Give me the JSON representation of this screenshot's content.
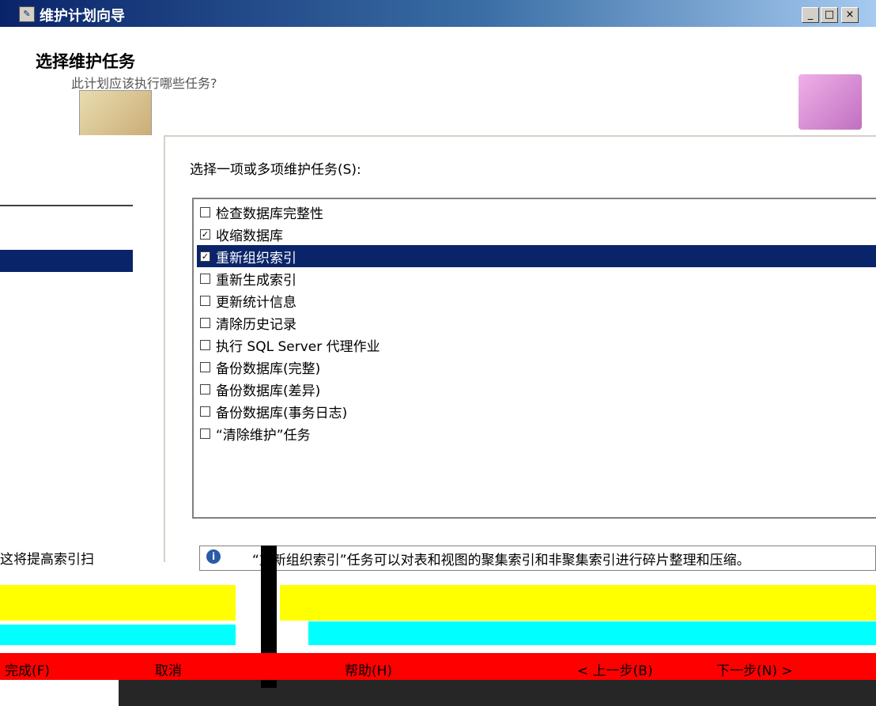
{
  "window": {
    "title": "维护计划向导",
    "minimize": "_",
    "maximize": "□",
    "close": "×"
  },
  "header": {
    "title": "选择维护任务",
    "subtitle": "此计划应该执行哪些任务?"
  },
  "main": {
    "prompt": "选择一项或多项维护任务(S):",
    "tasks": [
      {
        "label": "检查数据库完整性",
        "checked": false,
        "selected": false
      },
      {
        "label": "收缩数据库",
        "checked": true,
        "selected": false
      },
      {
        "label": "重新组织索引",
        "checked": true,
        "selected": true
      },
      {
        "label": "重新生成索引",
        "checked": false,
        "selected": false
      },
      {
        "label": "更新统计信息",
        "checked": false,
        "selected": false
      },
      {
        "label": "清除历史记录",
        "checked": false,
        "selected": false
      },
      {
        "label": "执行 SQL Server 代理作业",
        "checked": false,
        "selected": false
      },
      {
        "label": "备份数据库(完整)",
        "checked": false,
        "selected": false
      },
      {
        "label": "备份数据库(差异)",
        "checked": false,
        "selected": false
      },
      {
        "label": "备份数据库(事务日志)",
        "checked": false,
        "selected": false
      },
      {
        "label": "“清除维护”任务",
        "checked": false,
        "selected": false
      }
    ],
    "description": "“重新组织索引”任务可以对表和视图的聚集索引和非聚集索引进行碎片整理和压缩。",
    "description_left": "这将提高索引扫"
  },
  "buttons": {
    "finish": "完成(F)",
    "cancel": "取消",
    "help": "帮助(H)",
    "back": "< 上一步(B)",
    "next": "下一步(N) >"
  },
  "icons": {
    "title": "wizard-app-icon",
    "info": "info-icon",
    "check": "✓"
  }
}
